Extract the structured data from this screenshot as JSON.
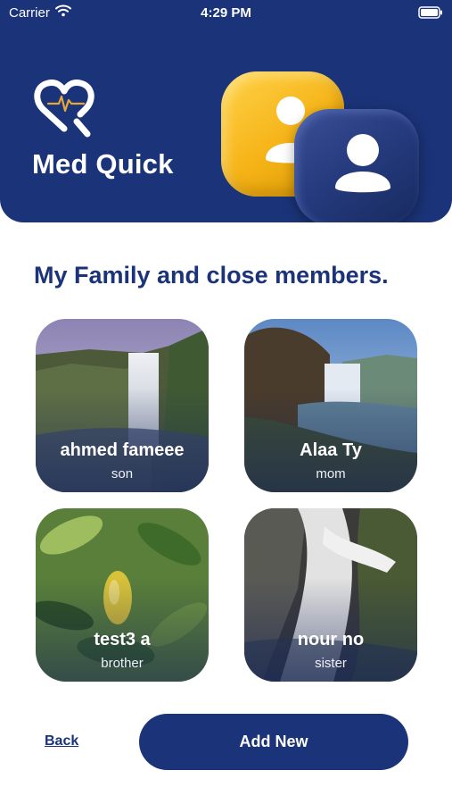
{
  "status_bar": {
    "carrier": "Carrier",
    "time": "4:29 PM"
  },
  "header": {
    "brand": "Med Quick"
  },
  "section": {
    "title": "My Family and close members."
  },
  "members": [
    {
      "name": "ahmed fameee",
      "relation": "son"
    },
    {
      "name": "Alaa Ty",
      "relation": "mom"
    },
    {
      "name": "test3 a",
      "relation": "brother"
    },
    {
      "name": "nour no",
      "relation": "sister"
    }
  ],
  "footer": {
    "back_label": "Back",
    "add_label": "Add New"
  },
  "colors": {
    "primary": "#1b3378",
    "accent": "#f5b316",
    "background": "#ffffff"
  }
}
